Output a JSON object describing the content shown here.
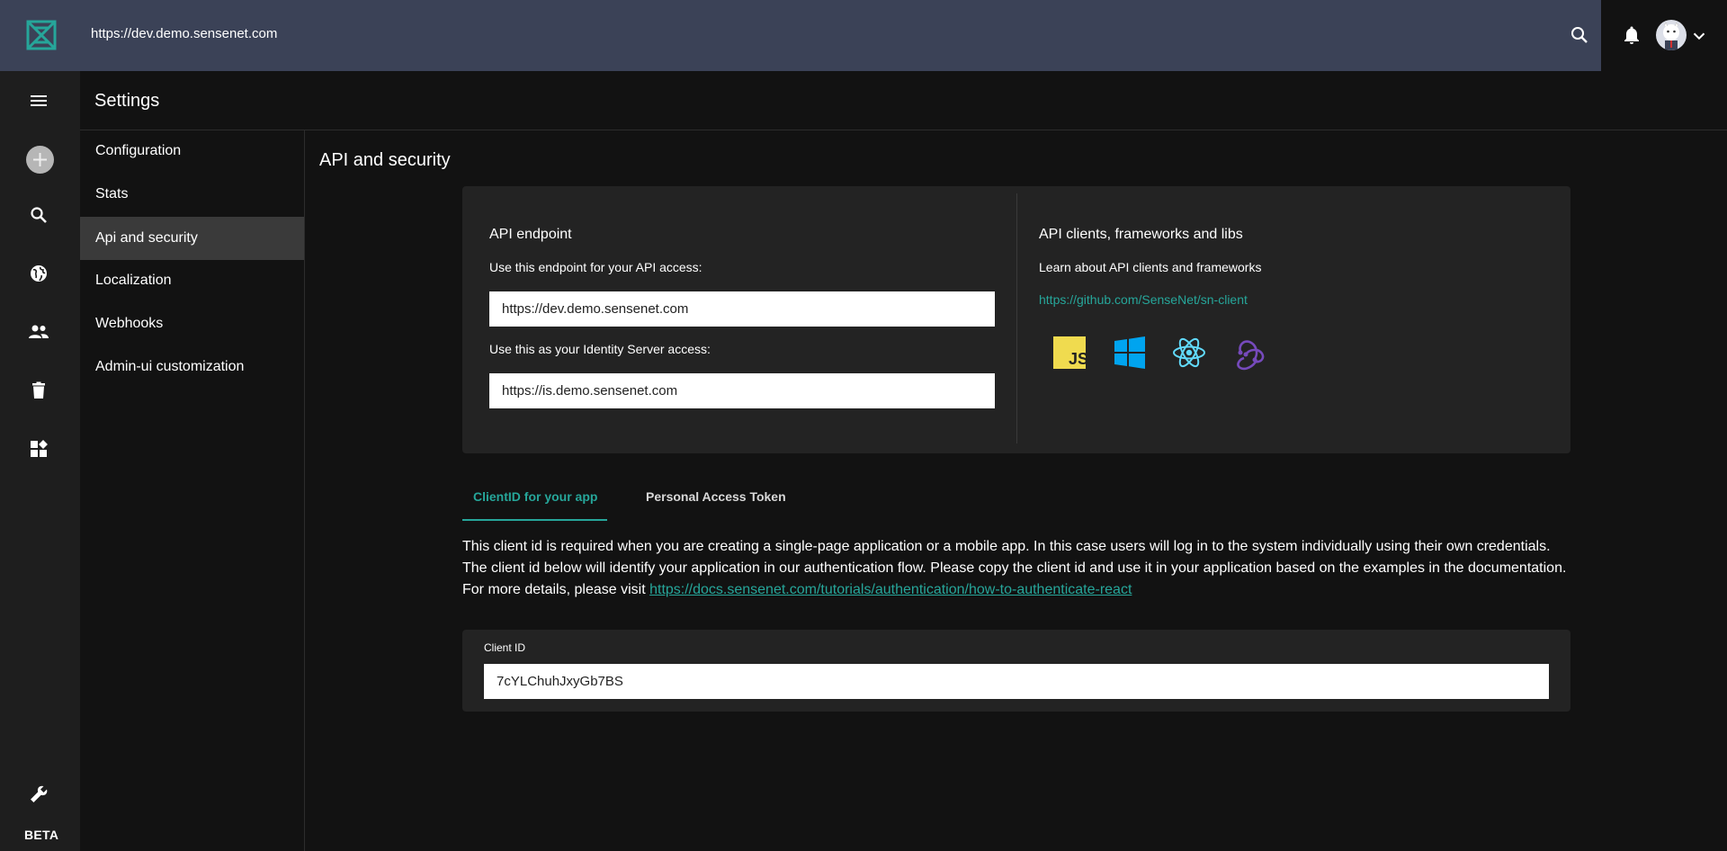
{
  "topbar": {
    "url": "https://dev.demo.sensenet.com",
    "colors": {
      "bar": "#3b4257",
      "accent": "#26a69a"
    }
  },
  "rail": {
    "icons": [
      "menu-icon",
      "add-icon",
      "search-icon",
      "globe-icon",
      "users-icon",
      "trash-icon",
      "dashboard-icon",
      "wrench-icon"
    ],
    "beta_label": "BETA"
  },
  "settings": {
    "title": "Settings",
    "menu": [
      {
        "label": "Configuration"
      },
      {
        "label": "Stats"
      },
      {
        "label": "Api and security",
        "active": true
      },
      {
        "label": "Localization"
      },
      {
        "label": "Webhooks"
      },
      {
        "label": "Admin-ui customization"
      }
    ]
  },
  "main": {
    "title": "API and security",
    "api_endpoint": {
      "heading": "API endpoint",
      "endpoint_label": "Use this endpoint for your API access:",
      "endpoint_value": "https://dev.demo.sensenet.com",
      "identity_label": "Use this as your Identity Server access:",
      "identity_value": "https://is.demo.sensenet.com"
    },
    "clients": {
      "heading": "API clients, frameworks and libs",
      "learn": "Learn about API clients and frameworks",
      "link": "https://github.com/SenseNet/sn-client",
      "libs": [
        "javascript-icon",
        "windows-icon",
        "react-icon",
        "redux-icon"
      ]
    },
    "tabs": [
      {
        "label": "ClientID for your app",
        "active": true
      },
      {
        "label": "Personal Access Token",
        "active": false
      }
    ],
    "description": "This client id is required when you are creating a single-page application or a mobile app. In this case users will log in to the system individually using their own credentials. The client id below will identify your application in our authentication flow. Please copy the client id and use it in your application based on the examples in the documentation. For more details, please visit",
    "description_link": "https://docs.sensenet.com/tutorials/authentication/how-to-authenticate-react",
    "client_id": {
      "label": "Client ID",
      "value": "7cYLChuhJxyGb7BS"
    }
  }
}
